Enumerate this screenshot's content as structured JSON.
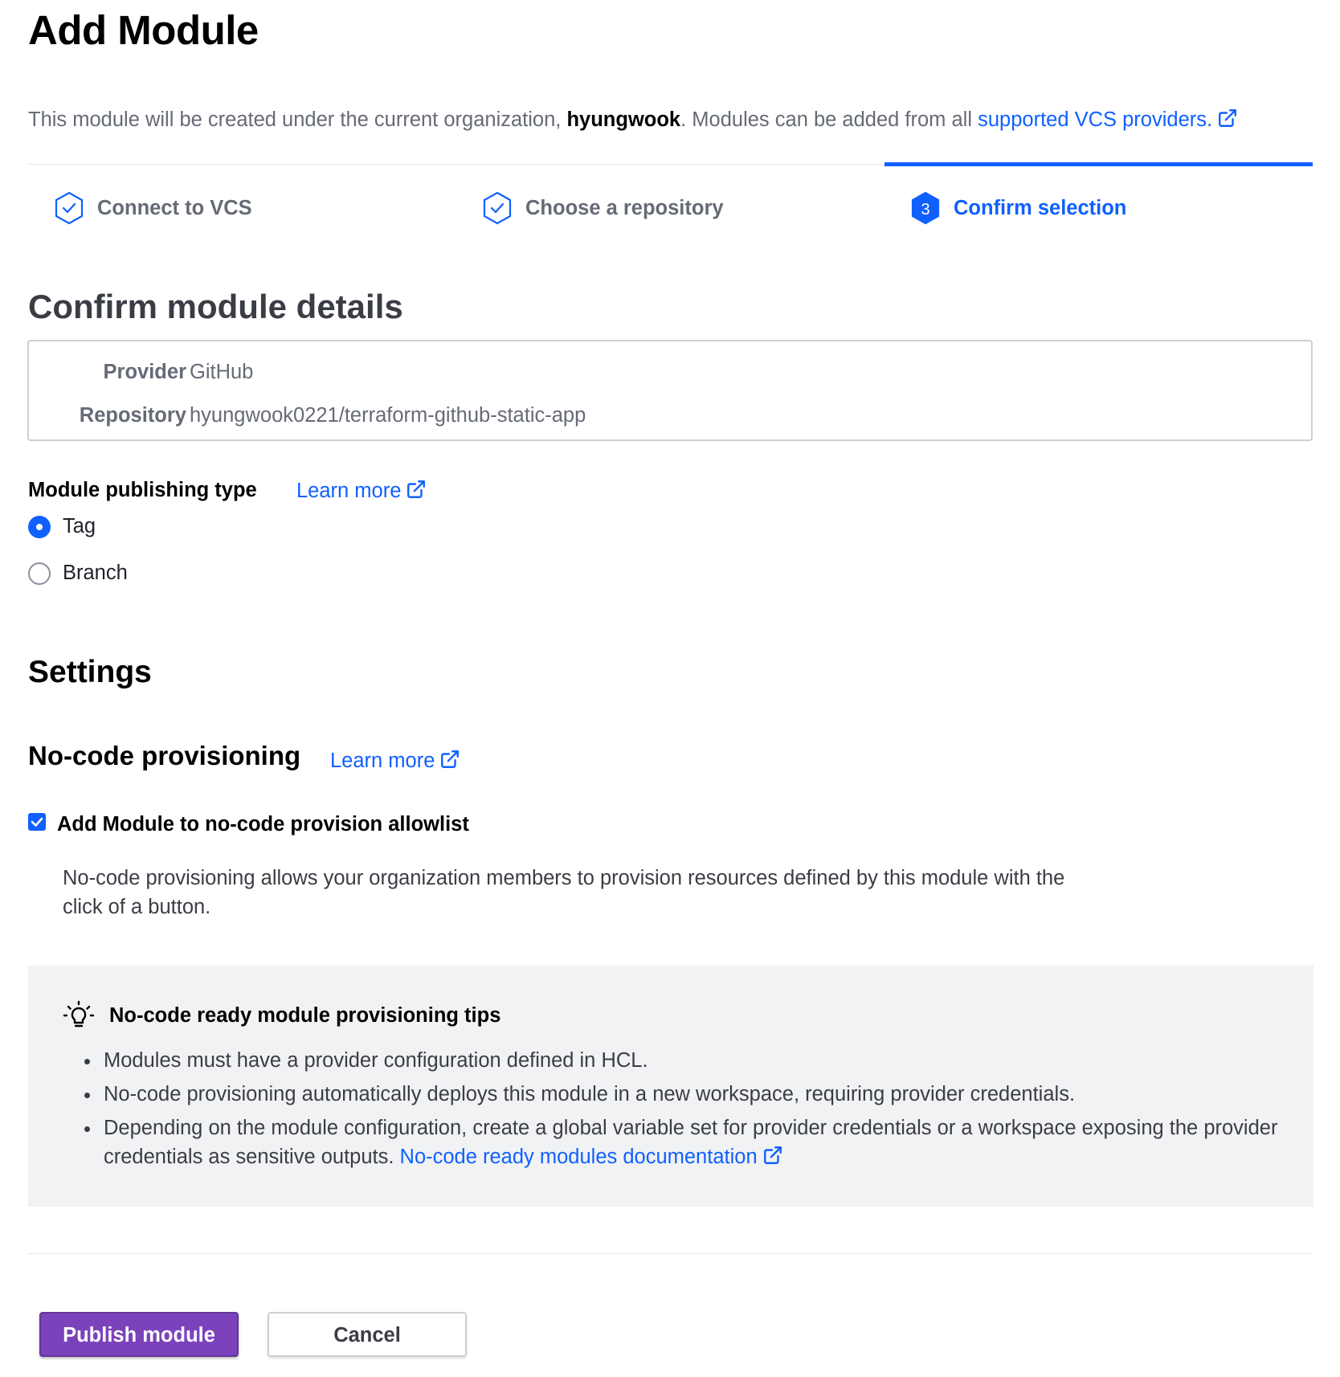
{
  "page": {
    "title": "Add Module"
  },
  "intro": {
    "text_before": "This module will be created under the current organization, ",
    "organization": "hyungwook",
    "text_after": ". Modules can be added from all ",
    "link_text": "supported VCS providers."
  },
  "stepper": {
    "steps": [
      {
        "label": "Connect to VCS",
        "state": "complete"
      },
      {
        "label": "Choose a repository",
        "state": "complete"
      },
      {
        "label": "Confirm selection",
        "state": "active",
        "number": "3"
      }
    ]
  },
  "confirm": {
    "title": "Confirm module details",
    "details": [
      {
        "key": "Provider",
        "value": "GitHub"
      },
      {
        "key": "Repository",
        "value": "hyungwook0221/terraform-github-static-app"
      }
    ]
  },
  "publishing_type": {
    "label": "Module publishing type",
    "learn_more": "Learn more",
    "options": [
      {
        "label": "Tag",
        "checked": true
      },
      {
        "label": "Branch",
        "checked": false
      }
    ]
  },
  "settings": {
    "title": "Settings",
    "nocode": {
      "title": "No-code provisioning",
      "learn_more": "Learn more",
      "checkbox_label": "Add Module to no-code provision allowlist",
      "checkbox_checked": true,
      "help_text": "No-code provisioning allows your organization members to provision resources defined by this module with the click of a button."
    },
    "tips": {
      "title": "No-code ready module provisioning tips",
      "items": [
        "Modules must have a provider configuration defined in HCL.",
        "No-code provisioning automatically deploys this module in a new workspace, requiring provider credentials.",
        "Depending on the module configuration, create a global variable set for provider credentials or a workspace exposing the provider credentials as sensitive outputs. "
      ],
      "doc_link": "No-code ready modules documentation"
    }
  },
  "actions": {
    "publish": "Publish module",
    "cancel": "Cancel"
  },
  "colors": {
    "accent": "#1060ff",
    "primary_button": "#7b42bc",
    "tips_background": "#f1f2f3"
  },
  "icons": {
    "external_link": "external-link-icon",
    "step_complete": "check-hexagon-icon",
    "step_active": "numbered-hexagon-icon",
    "tip": "lightbulb-icon"
  }
}
